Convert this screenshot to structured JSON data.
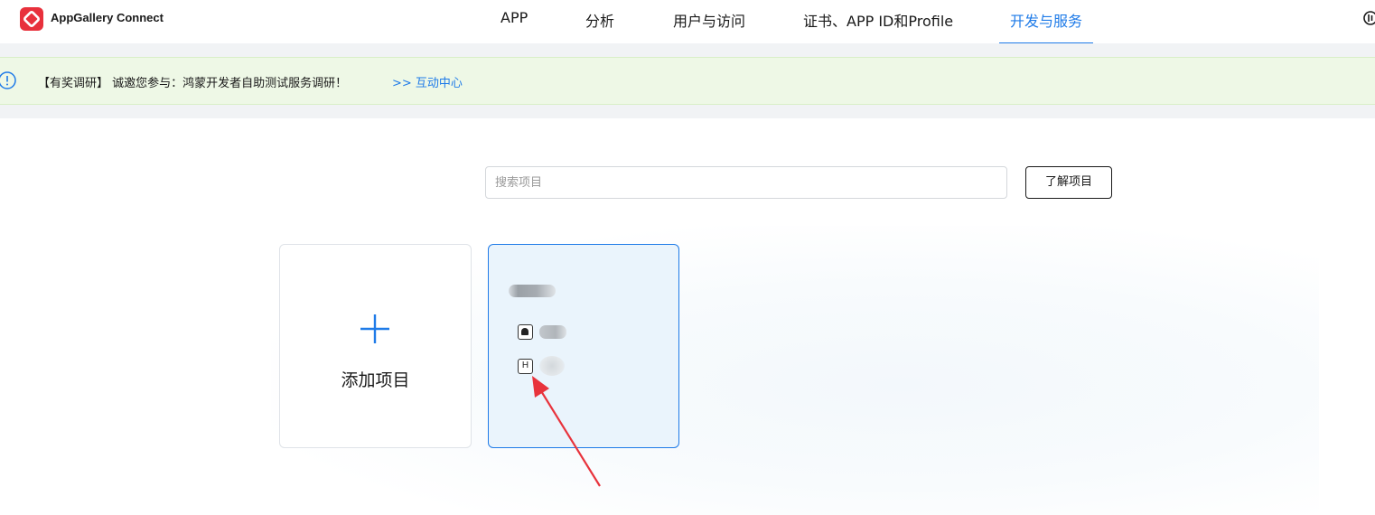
{
  "header": {
    "brand": "AppGallery Connect",
    "nav": [
      {
        "label": "APP",
        "active": false
      },
      {
        "label": "分析",
        "active": false
      },
      {
        "label": "用户与访问",
        "active": false
      },
      {
        "label": "证书、APP ID和Profile",
        "active": false
      },
      {
        "label": "开发与服务",
        "active": true
      }
    ],
    "power_icon": "power-icon"
  },
  "notice": {
    "icon": "info-icon",
    "text": "【有奖调研】 诚邀您参与：鸿蒙开发者自助测试服务调研！",
    "link": ">> 互动中心"
  },
  "search": {
    "placeholder": "搜索项目",
    "value": ""
  },
  "learn_button": "了解项目",
  "add_card": {
    "label": "添加项目",
    "icon": "plus-icon"
  },
  "project_card": {
    "android_icon": "android-icon",
    "harmony_icon_text": "H"
  },
  "colors": {
    "accent": "#1f7be8",
    "brand_red": "#e8313c",
    "notice_bg": "#eef8e6",
    "card_bg": "#eaf4fc",
    "annotation_arrow": "#e8333c"
  }
}
